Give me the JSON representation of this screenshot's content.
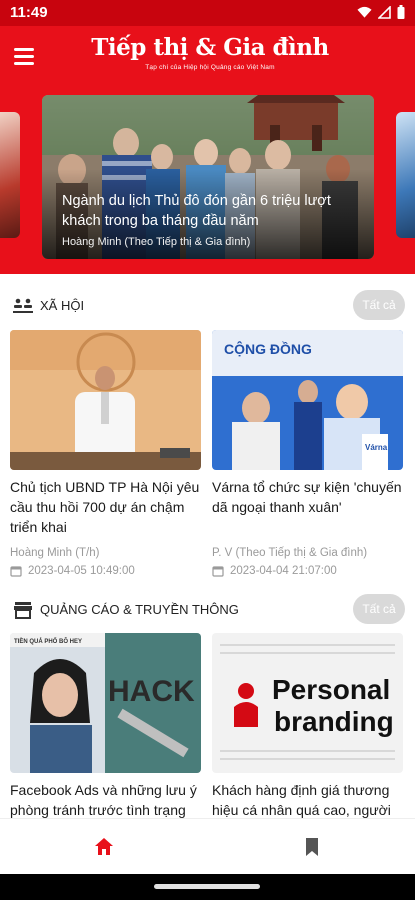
{
  "status_bar": {
    "time": "11:49",
    "icons": [
      "wifi-icon",
      "signal-icon",
      "battery-icon"
    ]
  },
  "app_bar": {
    "title": "Tiếp thị & Gia đình",
    "subtitle": "Tạp chí của Hiệp hội Quảng cáo Việt Nam",
    "menu_icon": "hamburger-menu-icon",
    "color": "#e8101a"
  },
  "hero": {
    "title": "Ngành du lịch Thủ đô đón gần 6 triệu lượt khách trong ba tháng đầu năm",
    "author": "Hoàng Minh (Theo Tiếp thị & Gia đình)"
  },
  "sections": [
    {
      "title": "XÃ HỘI",
      "icon": "community-icon",
      "see_all": "Tất cả",
      "articles": [
        {
          "title": "Chủ tịch UBND TP Hà Nội yêu cầu thu hồi 700 dự án chậm triển khai",
          "source": "Hoàng Minh (T/h)",
          "date": "2023-04-05 10:49:00"
        },
        {
          "title": "Várna tổ chức sự kiện 'chuyến dã ngoại thanh xuân'",
          "source": "P. V (Theo Tiếp thị & Gia đình)",
          "date": "2023-04-04 21:07:00",
          "image_banner": "CỘNG ĐỒNG",
          "image_brand": "Várna"
        }
      ]
    },
    {
      "title": "QUẢNG CÁO & TRUYỀN THÔNG",
      "icon": "storefront-icon",
      "see_all": "Tất cả",
      "articles": [
        {
          "title": "Facebook Ads và những lưu ý phòng tránh trước tình trạng",
          "image_caption": "TIỀN QUẢ PHỔ BÔ HEY",
          "image_word": "HACK"
        },
        {
          "title": "Khách hàng định giá thương hiệu cá nhân quá cao, người",
          "image_line1": "Personal",
          "image_line2": "branding"
        }
      ]
    }
  ],
  "bottom_nav": {
    "items": [
      "home-icon",
      "bookmark-icon"
    ],
    "active_color": "#e8101a",
    "inactive_color": "#555555"
  }
}
